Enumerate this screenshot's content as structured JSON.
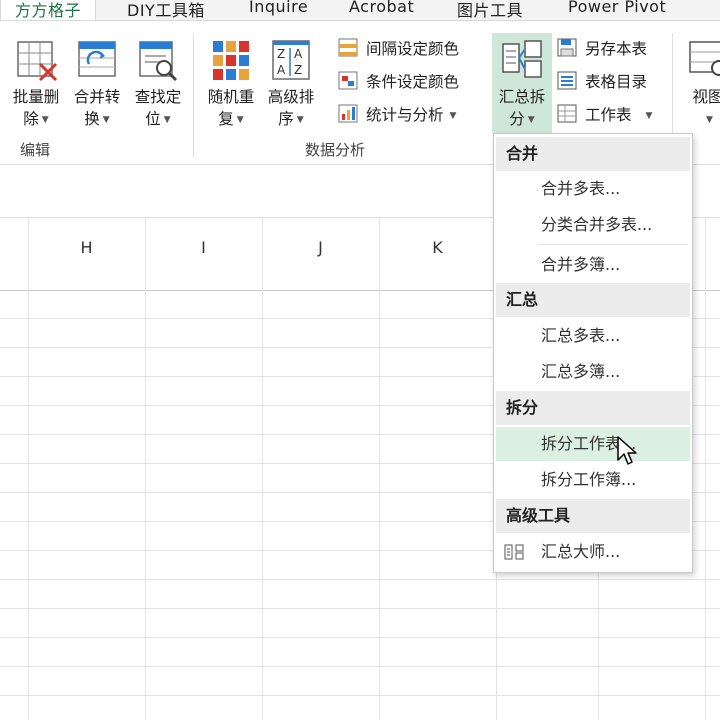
{
  "tabs": [
    "方方格子",
    "DIY工具箱",
    "Inquire",
    "Acrobat",
    "图片工具",
    "Power Pivot"
  ],
  "ribbon": {
    "edit_group": {
      "label": "编辑",
      "buttons": [
        {
          "line1": "批量删",
          "line2": "除"
        },
        {
          "line1": "合并转",
          "line2": "换"
        },
        {
          "line1": "查找定",
          "line2": "位"
        }
      ]
    },
    "analysis_group": {
      "label": "数据分析",
      "buttons": [
        {
          "line1": "随机重",
          "line2": "复"
        },
        {
          "line1": "高级排",
          "line2": "序"
        }
      ],
      "small_buttons": [
        {
          "label": "间隔设定颜色",
          "has_dropdown": false
        },
        {
          "label": "条件设定颜色",
          "has_dropdown": false
        },
        {
          "label": "统计与分析",
          "has_dropdown": true
        }
      ]
    },
    "summary_button": {
      "line1": "汇总拆",
      "line2": "分"
    },
    "side_small_buttons": [
      {
        "label": "另存本表",
        "has_dropdown": false
      },
      {
        "label": "表格目录",
        "has_dropdown": false
      },
      {
        "label": "工作表",
        "has_dropdown": true
      }
    ],
    "view_button": {
      "line1": "视图",
      "line2": ""
    }
  },
  "sheet": {
    "columns": [
      "H",
      "I",
      "J",
      "K"
    ]
  },
  "menu": {
    "sections": [
      {
        "header": "合并",
        "items": [
          "合并多表...",
          "分类合并多表...",
          "合并多簿..."
        ]
      },
      {
        "header": "汇总",
        "items": [
          "汇总多表...",
          "汇总多簿..."
        ]
      },
      {
        "header": "拆分",
        "items": [
          "拆分工作表...",
          "拆分工作簿..."
        ]
      },
      {
        "header": "高级工具",
        "items": [
          "汇总大师..."
        ]
      }
    ],
    "hovered_item": "拆分工作表..."
  },
  "colors": {
    "accent_green": "#1e7145",
    "pressed_bg": "#cfe7d8",
    "hover_bg": "#dbefe2"
  }
}
